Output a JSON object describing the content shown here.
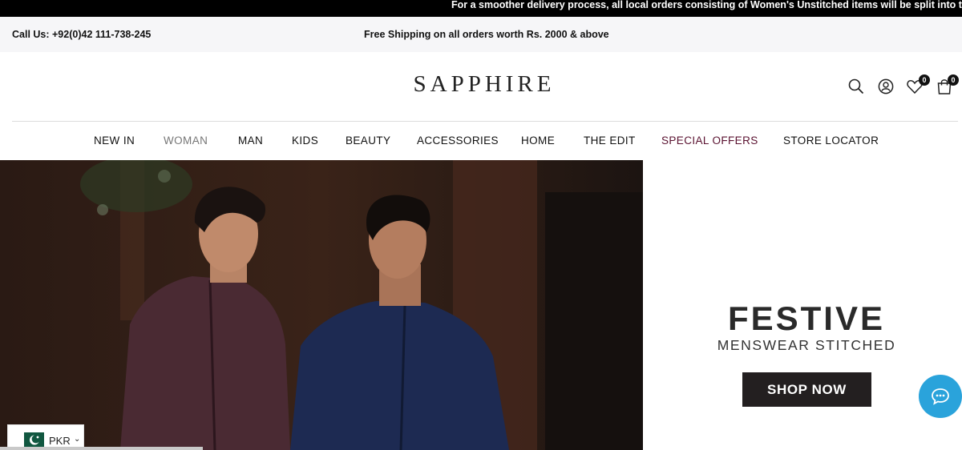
{
  "announcement": {
    "text": "For a smoother delivery process, all local orders consisting of Women's Unstitched items will be split into tw"
  },
  "topbar": {
    "call": "Call Us: +92(0)42 111-738-245",
    "shipping": "Free Shipping on all orders worth Rs. 2000 & above"
  },
  "header": {
    "logo": "SAPPHIRE",
    "wishlist_count": "0",
    "cart_count": "0",
    "icons": [
      "search-icon",
      "user-icon",
      "heart-icon",
      "bag-icon"
    ]
  },
  "nav": {
    "items": [
      {
        "label": "NEW IN"
      },
      {
        "label": "WOMAN"
      },
      {
        "label": "MAN"
      },
      {
        "label": "KIDS"
      },
      {
        "label": "BEAUTY"
      },
      {
        "label": "ACCESSORIES"
      },
      {
        "label": "HOME"
      },
      {
        "label": "THE EDIT"
      },
      {
        "label": "SPECIAL OFFERS"
      },
      {
        "label": "STORE LOCATOR"
      }
    ],
    "offer_color": "#5a1230"
  },
  "promo": {
    "title": "FESTIVE",
    "subtitle": "MENSWEAR STITCHED",
    "cta": "SHOP NOW"
  },
  "currency": {
    "code": "PKR"
  },
  "colors": {
    "chat_button": "#2aa3db",
    "cta_background": "#231f20"
  }
}
